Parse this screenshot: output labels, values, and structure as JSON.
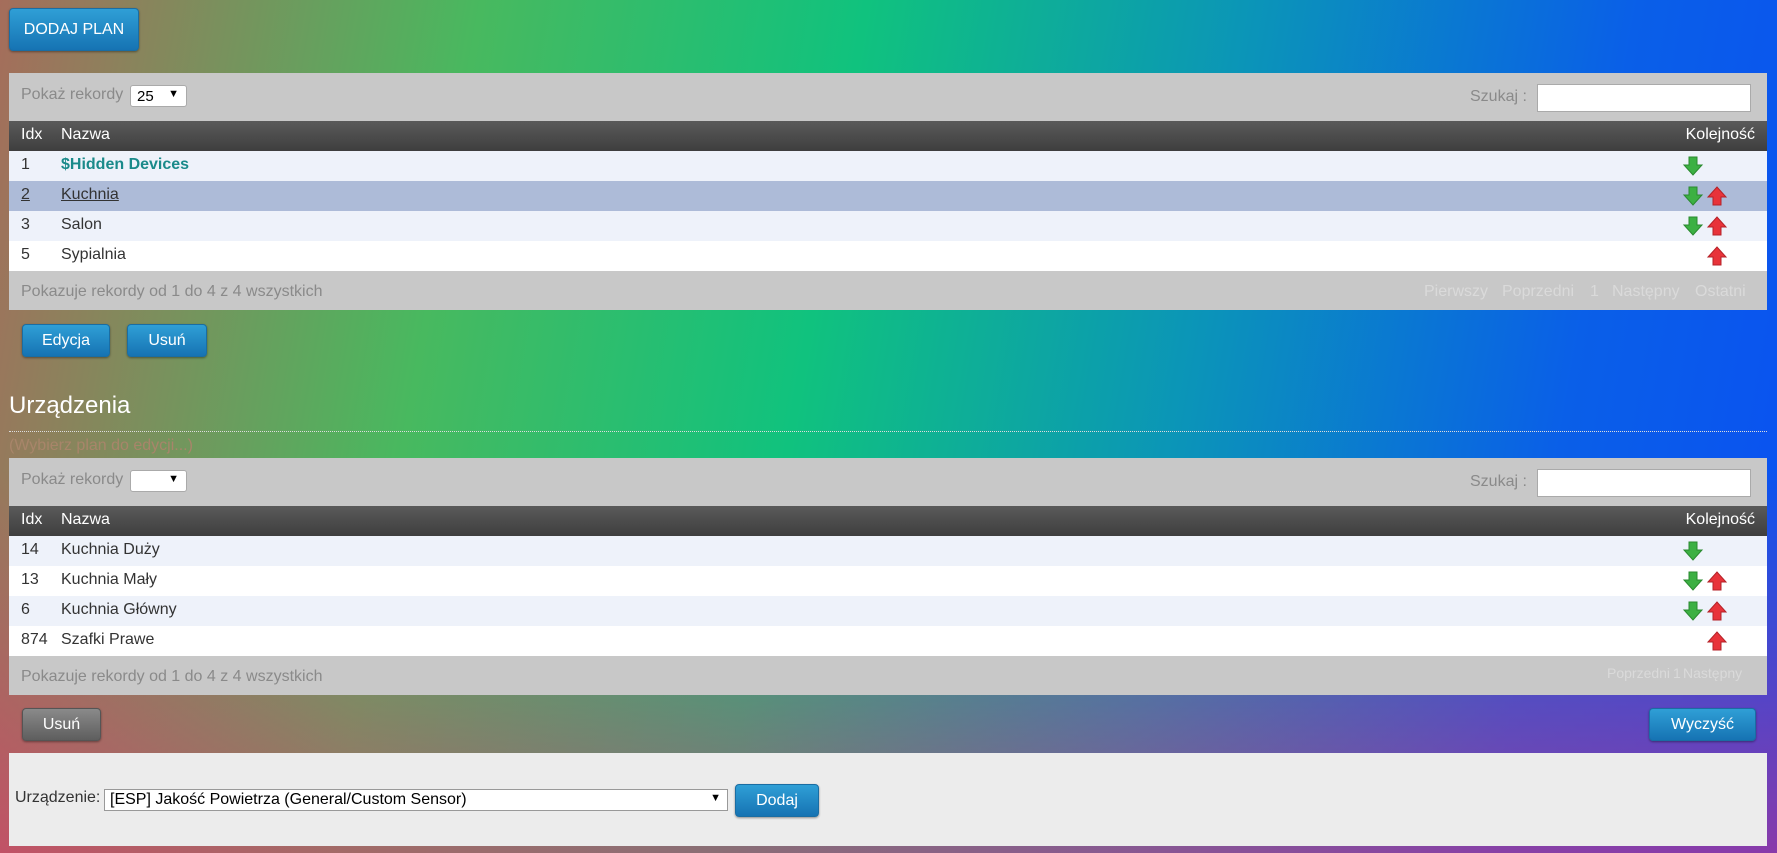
{
  "top_button": {
    "label": "DODAJ PLAN"
  },
  "plans": {
    "show_records_label": "Pokaż rekordy",
    "show_records_value": "25",
    "search_label": "Szukaj :",
    "search_value": "",
    "columns": {
      "idx": "Idx",
      "name": "Nazwa",
      "order": "Kolejność"
    },
    "rows": [
      {
        "idx": "1",
        "name": "$Hidden Devices"
      },
      {
        "idx": "2",
        "name": "Kuchnia"
      },
      {
        "idx": "3",
        "name": "Salon"
      },
      {
        "idx": "5",
        "name": "Sypialnia"
      }
    ],
    "info": "Pokazuje rekordy od 1 do 4 z 4 wszystkich",
    "pagination": {
      "first": "Pierwszy",
      "prev": "Poprzedni",
      "page": "1",
      "next": "Następny",
      "last": "Ostatni"
    },
    "edit_button": "Edycja",
    "delete_button": "Usuń"
  },
  "devices": {
    "heading": "Urządzenia",
    "hint": "(Wybierz plan do edycji...)",
    "show_records_label": "Pokaż rekordy",
    "show_records_value": "",
    "search_label": "Szukaj :",
    "search_value": "",
    "columns": {
      "idx": "Idx",
      "name": "Nazwa",
      "order": "Kolejność"
    },
    "rows": [
      {
        "idx": "14",
        "name": "Kuchnia Duży"
      },
      {
        "idx": "13",
        "name": "Kuchnia Mały"
      },
      {
        "idx": "6",
        "name": "Kuchnia Główny"
      },
      {
        "idx": "874",
        "name": "Szafki Prawe"
      }
    ],
    "info": "Pokazuje rekordy od 1 do 4 z 4 wszystkich",
    "pagination": {
      "prev": "Poprzedni",
      "page": "1",
      "next": "Następny"
    },
    "delete_button": "Usuń",
    "clear_button": "Wyczyść"
  },
  "add_device": {
    "label": "Urządzenie:",
    "selected": "[ESP] Jakość Powietrza (General/Custom Sensor)",
    "button": "Dodaj"
  },
  "colors": {
    "arrow_down": "#3cb043",
    "arrow_up": "#e8333a",
    "accent": "#1f86c4"
  },
  "icons": {
    "move_down": "arrow-down-icon",
    "move_up": "arrow-up-icon",
    "dropdown": "chevron-down-icon"
  }
}
